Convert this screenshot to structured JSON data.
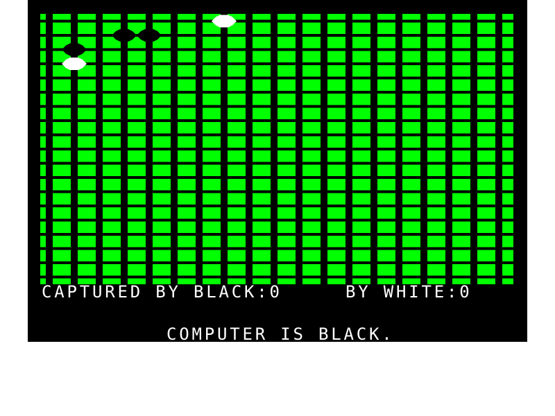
{
  "board": {
    "size": 19,
    "colors": {
      "board": "#00ff00",
      "grid": "#000000",
      "background": "#000000",
      "black_stone": "#000000",
      "white_stone": "#ffffff"
    },
    "stones": [
      {
        "col": 8,
        "row": 1,
        "color": "white"
      },
      {
        "col": 4,
        "row": 2,
        "color": "black"
      },
      {
        "col": 5,
        "row": 2,
        "color": "black"
      },
      {
        "col": 2,
        "row": 3,
        "color": "black"
      },
      {
        "col": 2,
        "row": 4,
        "color": "white"
      }
    ]
  },
  "status": {
    "captured_black_label": "CAPTURED BY BLACK:",
    "captured_black_value": "0",
    "captured_white_label": "BY WHITE:",
    "captured_white_value": "0",
    "message": "COMPUTER IS BLACK."
  }
}
